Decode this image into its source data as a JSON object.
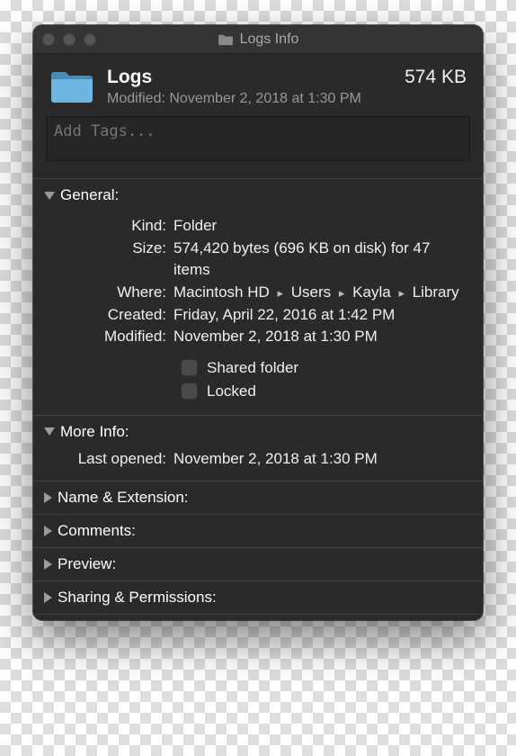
{
  "window": {
    "title": "Logs Info"
  },
  "header": {
    "name": "Logs",
    "size": "574 KB",
    "modified_prefix": "Modified:",
    "modified_value": "November 2, 2018 at 1:30 PM"
  },
  "tags": {
    "placeholder": "Add Tags..."
  },
  "sections": {
    "general": {
      "title": "General:",
      "kind_label": "Kind:",
      "kind_value": "Folder",
      "size_label": "Size:",
      "size_value": "574,420 bytes (696 KB on disk) for 47 items",
      "where_label": "Where:",
      "where_parts": [
        "Macintosh HD",
        "Users",
        "Kayla",
        "Library"
      ],
      "created_label": "Created:",
      "created_value": "Friday, April 22, 2016 at 1:42 PM",
      "modified_label": "Modified:",
      "modified_value": "November 2, 2018 at 1:30 PM",
      "shared_label": "Shared folder",
      "locked_label": "Locked"
    },
    "more_info": {
      "title": "More Info:",
      "last_opened_label": "Last opened:",
      "last_opened_value": "November 2, 2018 at 1:30 PM"
    },
    "name_ext": {
      "title": "Name & Extension:"
    },
    "comments": {
      "title": "Comments:"
    },
    "preview": {
      "title": "Preview:"
    },
    "sharing": {
      "title": "Sharing & Permissions:"
    }
  }
}
